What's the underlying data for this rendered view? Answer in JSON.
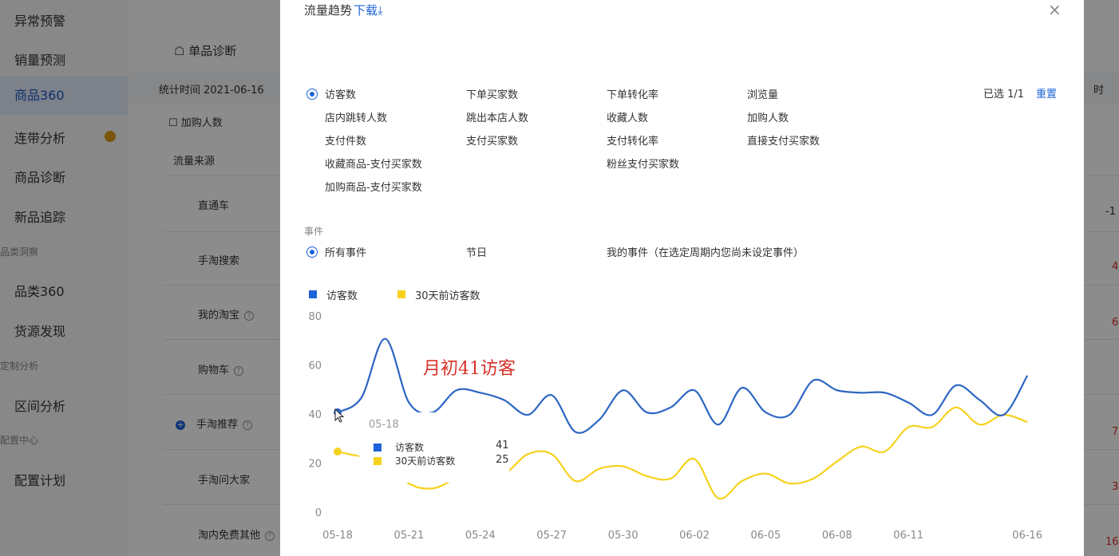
{
  "sidebar": {
    "items": [
      {
        "label": "异常预警"
      },
      {
        "label": "销量预测"
      },
      {
        "label": "商品360"
      },
      {
        "label": "连带分析"
      },
      {
        "label": "商品诊断"
      },
      {
        "label": "新品追踪"
      },
      {
        "label": "品类360"
      },
      {
        "label": "货源发现"
      },
      {
        "label": "区间分析"
      },
      {
        "label": "配置计划"
      }
    ],
    "groups": [
      "品类洞察",
      "定制分析",
      "配置中心"
    ]
  },
  "background": {
    "tab": "单品诊断",
    "stat_time": "统计时间 2021-06-16",
    "checkbox_label": "加购人数",
    "source_header": "流量来源",
    "sources": [
      "直通车",
      "手淘搜索",
      "我的淘宝",
      "购物车",
      "手淘推荐",
      "手淘问大家",
      "淘内免费其他"
    ],
    "right_cut": [
      "时",
      "-1",
      "4",
      "6",
      "7",
      "3",
      "16"
    ]
  },
  "modal": {
    "title": "流量趋势",
    "download": "下载",
    "selected": "已选 1/1",
    "reset": "重置",
    "metrics": [
      "访客数",
      "下单买家数",
      "下单转化率",
      "浏览量",
      "店内跳转人数",
      "跳出本店人数",
      "收藏人数",
      "加购人数",
      "支付件数",
      "支付买家数",
      "支付转化率",
      "直接支付买家数",
      "收藏商品-支付买家数",
      "粉丝支付买家数",
      "加购商品-支付买家数"
    ],
    "events_label": "事件",
    "events": [
      "所有事件",
      "节日",
      "我的事件（在选定周期内您尚未设定事件）"
    ]
  },
  "annotation": "月初41访客",
  "tooltip": {
    "date": "05-18",
    "rows": [
      {
        "label": "访客数",
        "value": "41",
        "color": "#1d63d9"
      },
      {
        "label": "30天前访客数",
        "value": "25",
        "color": "#f5d21e"
      }
    ]
  },
  "chart_data": {
    "type": "line",
    "legend": [
      "访客数",
      "30天前访客数"
    ],
    "y_ticks": [
      "0",
      "20",
      "40",
      "60",
      "80"
    ],
    "ylim": [
      0,
      80
    ],
    "x_ticks": [
      "05-18",
      "05-21",
      "05-24",
      "05-27",
      "05-30",
      "06-02",
      "06-05",
      "06-08",
      "06-11",
      "06-16"
    ],
    "x": [
      "05-18",
      "05-19",
      "05-20",
      "05-21",
      "05-22",
      "05-23",
      "05-24",
      "05-25",
      "05-26",
      "05-27",
      "05-28",
      "05-29",
      "05-30",
      "05-31",
      "06-01",
      "06-02",
      "06-03",
      "06-04",
      "06-05",
      "06-06",
      "06-07",
      "06-08",
      "06-09",
      "06-10",
      "06-11",
      "06-12",
      "06-13",
      "06-14",
      "06-15",
      "06-16"
    ],
    "series": [
      {
        "name": "访客数",
        "color": "#2c66c4",
        "values": [
          41,
          47,
          71,
          45,
          41,
          50,
          49,
          46,
          40,
          48,
          33,
          38,
          50,
          41,
          43,
          50,
          36,
          51,
          41,
          40,
          54,
          50,
          49,
          49,
          45,
          40,
          52,
          46,
          40,
          56
        ]
      },
      {
        "name": "30天前访客数",
        "color": "#f5d21e",
        "values": [
          25,
          23,
          22,
          12,
          10,
          14,
          17,
          16,
          24,
          24,
          13,
          18,
          19,
          15,
          14,
          22,
          6,
          13,
          16,
          12,
          14,
          21,
          27,
          25,
          35,
          35,
          43,
          36,
          40,
          37
        ]
      }
    ]
  }
}
